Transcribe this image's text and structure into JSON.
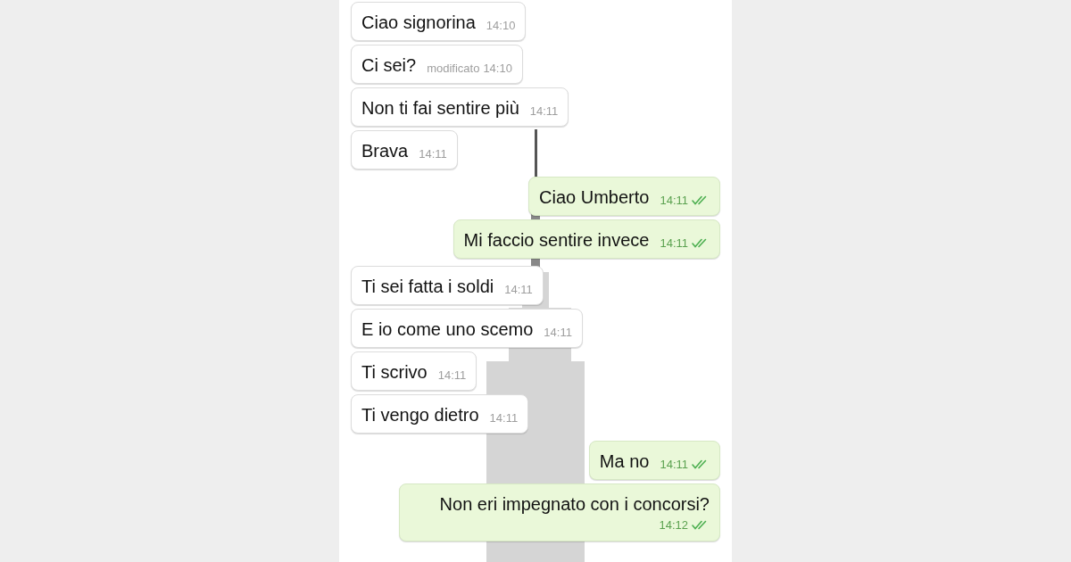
{
  "messages": [
    {
      "kind": "received",
      "text": "Ciao signorina",
      "time": "14:10"
    },
    {
      "kind": "received",
      "text": "Ci sei?",
      "edited": "modificato",
      "time": "14:10"
    },
    {
      "kind": "received",
      "text": "Non ti fai sentire più",
      "time": "14:11"
    },
    {
      "kind": "received",
      "text": "Brava",
      "time": "14:11"
    },
    {
      "kind": "sent",
      "text": "Ciao Umberto",
      "time": "14:11",
      "read": true
    },
    {
      "kind": "sent",
      "text": "Mi faccio sentire invece",
      "time": "14:11",
      "read": true
    },
    {
      "kind": "received",
      "text": "Ti sei fatta i soldi",
      "time": "14:11"
    },
    {
      "kind": "received",
      "text": "E io come uno scemo",
      "time": "14:11"
    },
    {
      "kind": "received",
      "text": "Ti scrivo",
      "time": "14:11"
    },
    {
      "kind": "received",
      "text": "Ti vengo dietro",
      "time": "14:11"
    },
    {
      "kind": "sent",
      "text": "Ma no",
      "time": "14:11",
      "read": true
    },
    {
      "kind": "sent",
      "text": "Non eri impegnato con i concorsi?",
      "time": "14:12",
      "read": true
    }
  ]
}
